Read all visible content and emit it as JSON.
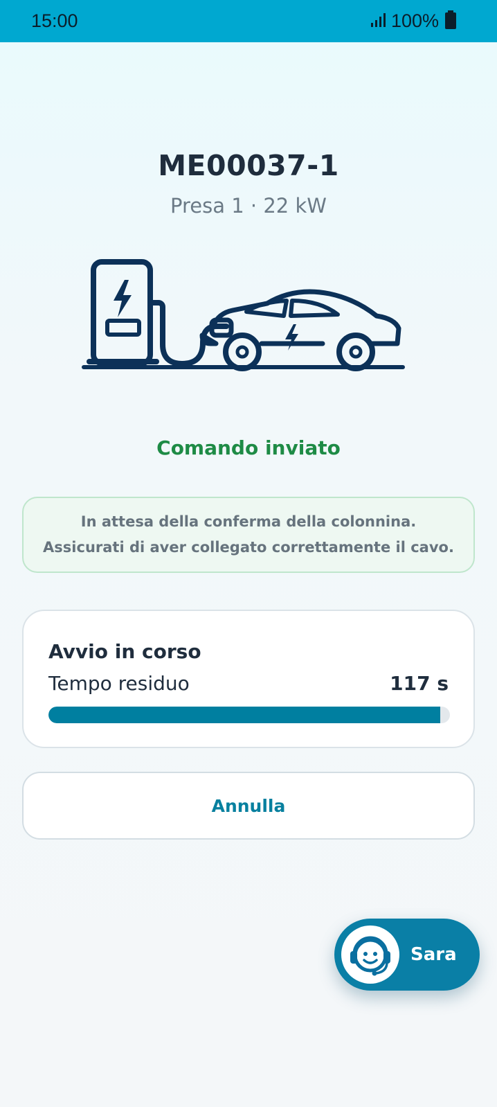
{
  "status_bar": {
    "time": "15:00",
    "battery": "100%",
    "icons": [
      "signal-icon",
      "battery-icon"
    ]
  },
  "station": {
    "id": "ME00037-1",
    "subtitle": "Presa 1 · 22 kW"
  },
  "illustration": {
    "icon": "ev-charging-station-car-icon"
  },
  "status": {
    "heading": "Comando inviato",
    "message": "In attesa della conferma della colonnina. Assicurati di aver collegato correttamente il cavo."
  },
  "progress": {
    "title": "Avvio in corso",
    "label": "Tempo residuo",
    "remaining": "117 s",
    "fraction": 0.975
  },
  "actions": {
    "cancel_label": "Annulla"
  },
  "assistant": {
    "label": "Sara",
    "icon": "headset-avatar-icon"
  },
  "colors": {
    "status_bar": "#00a8d0",
    "accent": "#007fa0",
    "success": "#1e8b45",
    "illustration": "#0c3158"
  }
}
